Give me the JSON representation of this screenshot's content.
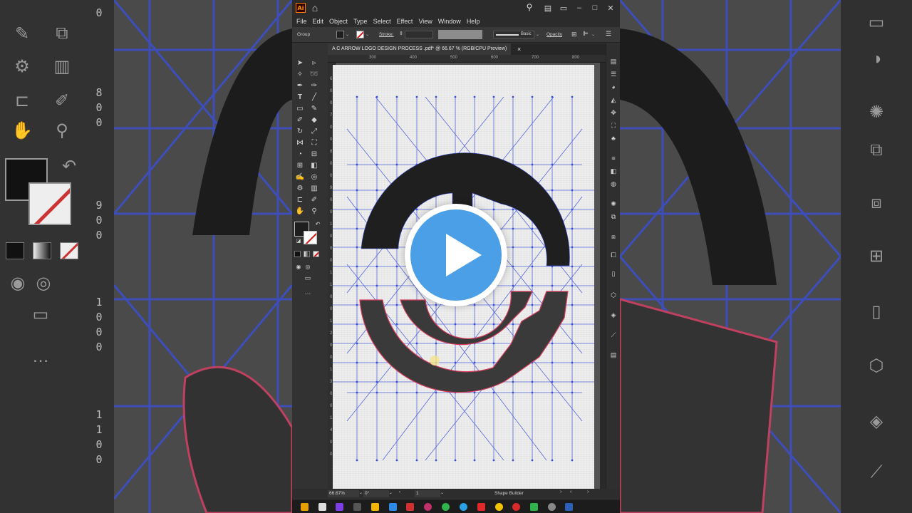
{
  "window": {
    "app_logo": "Ai",
    "doc_tab": "A C ARROW  LOGO DESIGN PROCESS .pdf* @ 66.67 % (RGB/CPU Preview)"
  },
  "menu": [
    "File",
    "Edit",
    "Object",
    "Type",
    "Select",
    "Effect",
    "View",
    "Window",
    "Help"
  ],
  "control_bar": {
    "selection": "Group",
    "stroke_label": "Stroke:",
    "brush_label": "Basic",
    "opacity_label": "Opacity"
  },
  "rulers": {
    "top": [
      "300",
      "400",
      "500",
      "600",
      "700",
      "800"
    ],
    "left": [
      "6",
      "0",
      "0",
      "7",
      "0",
      "0",
      "8",
      "0",
      "0",
      "9",
      "0",
      "0",
      "1",
      "0",
      "0",
      "0",
      "1",
      "1",
      "0",
      "0",
      "1",
      "2",
      "0",
      "0",
      "1",
      "3",
      "0",
      "0",
      "1",
      "4",
      "0",
      "0"
    ]
  },
  "status_bar": {
    "zoom": "66.67%",
    "rotation": "0°",
    "artboard": "1",
    "tool": "Shape Builder"
  },
  "background": {
    "digits": [
      "0",
      "8",
      "0",
      "0",
      "9",
      "0",
      "0",
      "1",
      "0",
      "0",
      "0",
      "1",
      "1",
      "0",
      "0"
    ]
  },
  "colors": {
    "accent": "#4a9fe6",
    "fill": "#1e1e1e",
    "stroke_none": "#dd1111",
    "guide": "#3a4fd8",
    "path": "#d43a5a"
  },
  "icons": {
    "home": "home-icon",
    "search": "search-icon",
    "play": "play-icon"
  }
}
